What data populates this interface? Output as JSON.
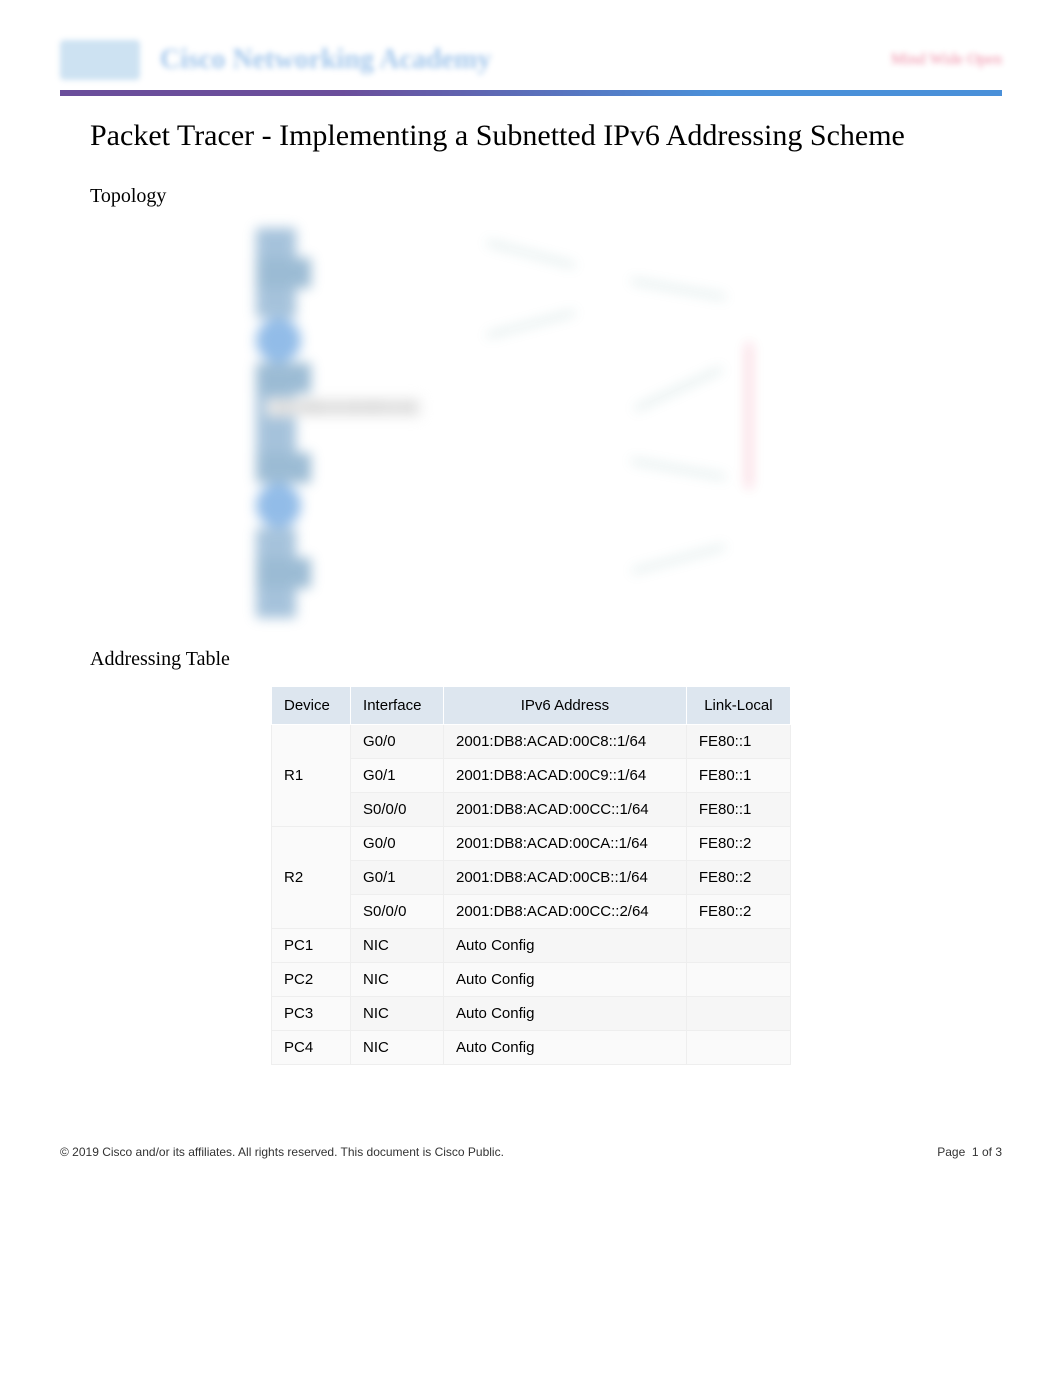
{
  "header": {
    "brand_text": "Cisco Networking Academy",
    "right_text": "Mind Wide Open"
  },
  "title": "Packet Tracer - Implementing a Subnetted IPv6 Addressing Scheme",
  "sections": {
    "topology": "Topology",
    "addressing_table": "Addressing Table"
  },
  "topology_label": "2001:DB8:ACAD:00C8::/64",
  "table": {
    "headers": {
      "device": "Device",
      "interface": "Interface",
      "ipv6": "IPv6 Address",
      "link_local": "Link-Local"
    },
    "rows": [
      {
        "device": "R1",
        "rowspan": 3,
        "interface": "G0/0",
        "ipv6": "2001:DB8:ACAD:00C8::1/64",
        "link_local": "FE80::1"
      },
      {
        "device": "",
        "rowspan": 0,
        "interface": "G0/1",
        "ipv6": "2001:DB8:ACAD:00C9::1/64",
        "link_local": "FE80::1"
      },
      {
        "device": "",
        "rowspan": 0,
        "interface": "S0/0/0",
        "ipv6": "2001:DB8:ACAD:00CC::1/64",
        "link_local": "FE80::1"
      },
      {
        "device": "R2",
        "rowspan": 3,
        "interface": "G0/0",
        "ipv6": "2001:DB8:ACAD:00CA::1/64",
        "link_local": "FE80::2"
      },
      {
        "device": "",
        "rowspan": 0,
        "interface": "G0/1",
        "ipv6": "2001:DB8:ACAD:00CB::1/64",
        "link_local": "FE80::2"
      },
      {
        "device": "",
        "rowspan": 0,
        "interface": "S0/0/0",
        "ipv6": "2001:DB8:ACAD:00CC::2/64",
        "link_local": "FE80::2"
      },
      {
        "device": "PC1",
        "rowspan": 1,
        "interface": "NIC",
        "ipv6": "Auto Config",
        "link_local": ""
      },
      {
        "device": "PC2",
        "rowspan": 1,
        "interface": "NIC",
        "ipv6": "Auto Config",
        "link_local": ""
      },
      {
        "device": "PC3",
        "rowspan": 1,
        "interface": "NIC",
        "ipv6": "Auto Config",
        "link_local": ""
      },
      {
        "device": "PC4",
        "rowspan": 1,
        "interface": "NIC",
        "ipv6": "Auto Config",
        "link_local": ""
      }
    ]
  },
  "footer": {
    "copyright": "© 2019 Cisco and/or its affiliates. All rights reserved. This document is Cisco Public.",
    "page_label": "Page",
    "page_current": "1",
    "page_of": "of",
    "page_total": "3"
  }
}
